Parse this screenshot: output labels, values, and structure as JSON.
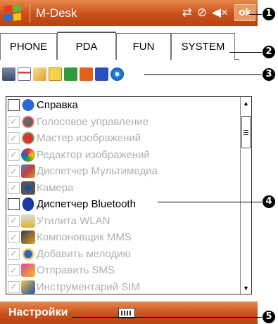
{
  "titlebar": {
    "app_title": "M-Desk",
    "ok_label": "ok",
    "status_icons": [
      "sync-icon",
      "no-connection-icon",
      "volume-icon"
    ]
  },
  "tabs": [
    {
      "label": "PHONE",
      "active": false
    },
    {
      "label": "PDA",
      "active": true
    },
    {
      "label": "FUN",
      "active": false
    },
    {
      "label": "SYSTEM",
      "active": false
    }
  ],
  "icon_row": [
    "calculator-icon",
    "calendar-icon",
    "messaging-icon",
    "notes-icon",
    "excel-icon",
    "powerpoint-icon",
    "word-icon",
    "internet-explorer-icon"
  ],
  "list": {
    "items": [
      {
        "label": "Справка",
        "checked": false,
        "enabled": true,
        "icon": "help-icon"
      },
      {
        "label": "Голосовое управление",
        "checked": true,
        "enabled": false,
        "icon": "voice-command-icon"
      },
      {
        "label": "Мастер изображений",
        "checked": true,
        "enabled": false,
        "icon": "image-wizard-icon"
      },
      {
        "label": "Редактор изображений",
        "checked": true,
        "enabled": false,
        "icon": "image-editor-icon"
      },
      {
        "label": "Диспетчер Мультимедиа",
        "checked": true,
        "enabled": false,
        "icon": "multimedia-manager-icon"
      },
      {
        "label": "Камера",
        "checked": true,
        "enabled": false,
        "icon": "camera-icon"
      },
      {
        "label": "Диспетчер Bluetooth",
        "checked": false,
        "enabled": true,
        "icon": "bluetooth-icon"
      },
      {
        "label": "Утилита WLAN",
        "checked": true,
        "enabled": false,
        "icon": "wlan-icon"
      },
      {
        "label": "Компоновщик MMS",
        "checked": true,
        "enabled": false,
        "icon": "mms-composer-icon"
      },
      {
        "label": "Добавить мелодию",
        "checked": true,
        "enabled": false,
        "icon": "add-ringtone-icon"
      },
      {
        "label": "Отправить SMS",
        "checked": true,
        "enabled": false,
        "icon": "send-sms-icon"
      },
      {
        "label": "Инструментарий SIM",
        "checked": true,
        "enabled": false,
        "icon": "sim-toolkit-icon"
      }
    ]
  },
  "bottombar": {
    "menu_label": "Настройки",
    "keyboard_icon": "keyboard-icon"
  },
  "callouts": [
    "1",
    "2",
    "3",
    "4",
    "5"
  ],
  "colors": {
    "bar_accent": "#c8501c",
    "disabled_text": "#b0b0b0"
  }
}
